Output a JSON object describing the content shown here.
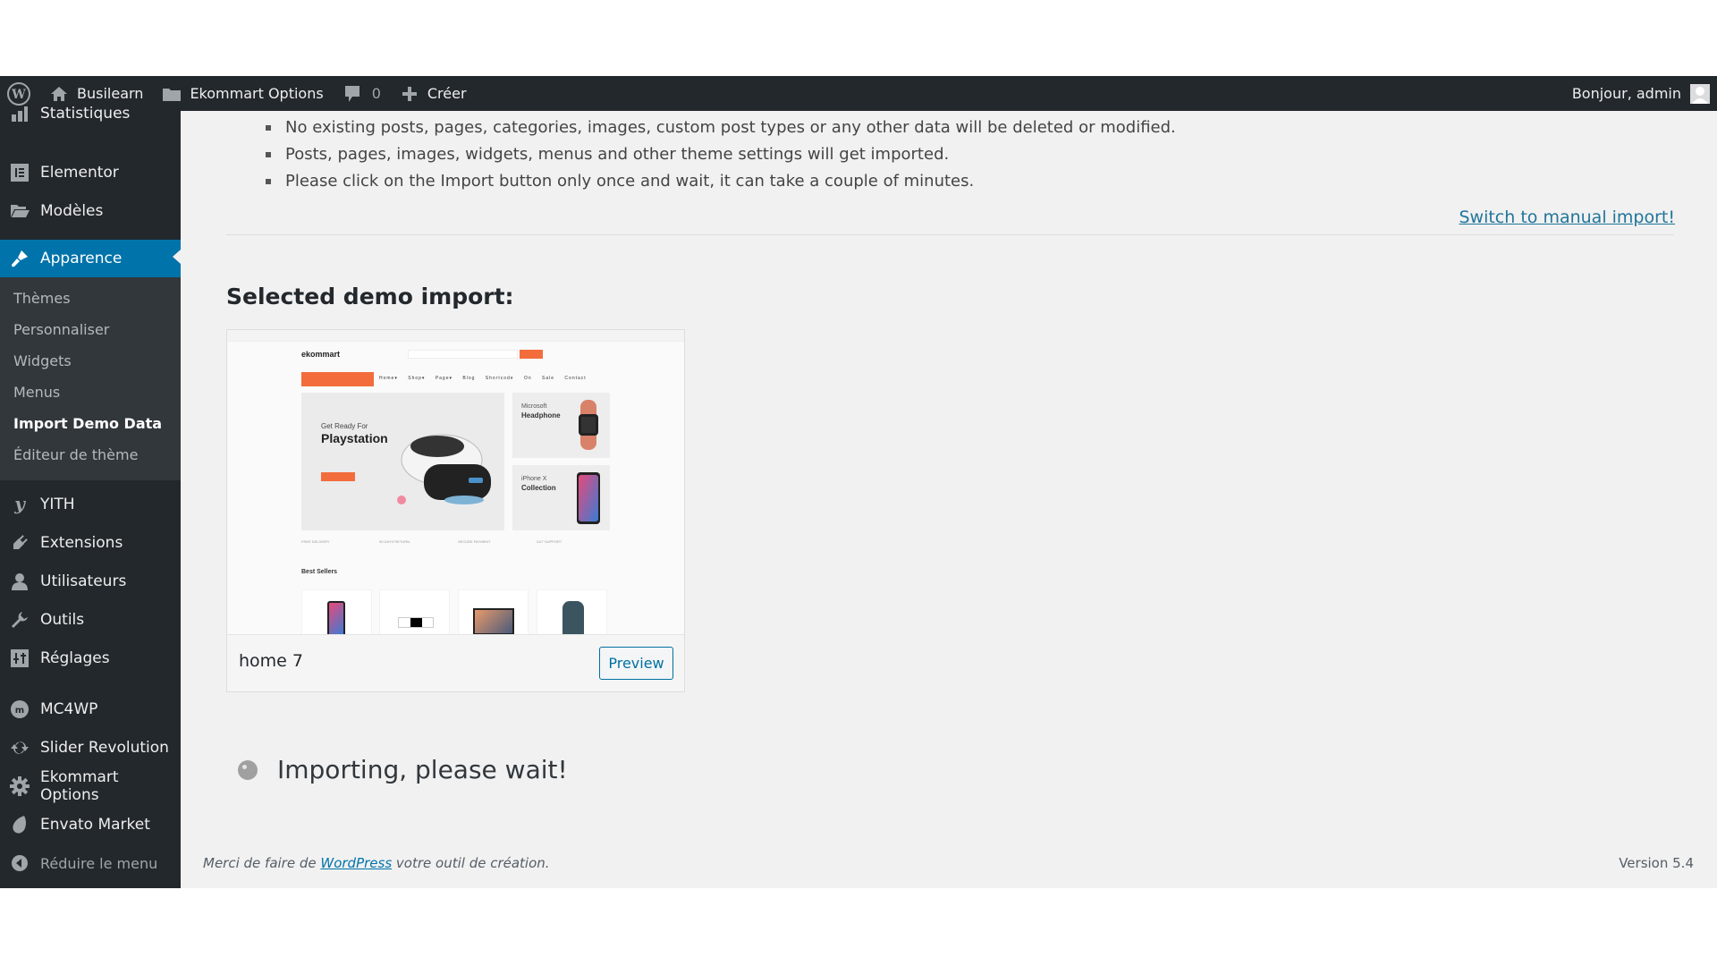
{
  "admin_bar": {
    "site_name": "Busilearn",
    "options_label": "Ekommart Options",
    "comments_count": "0",
    "create_label": "Créer",
    "greeting": "Bonjour, admin"
  },
  "sidebar": {
    "items": [
      {
        "label": "Statistiques",
        "icon": "bar-chart-icon"
      },
      {
        "label": "Elementor",
        "icon": "elementor-icon"
      },
      {
        "label": "Modèles",
        "icon": "folder-icon"
      },
      {
        "label": "Apparence",
        "icon": "paintbrush-icon",
        "active": true
      },
      {
        "label": "YITH",
        "icon": "yith-icon"
      },
      {
        "label": "Extensions",
        "icon": "plugin-icon"
      },
      {
        "label": "Utilisateurs",
        "icon": "user-icon"
      },
      {
        "label": "Outils",
        "icon": "wrench-icon"
      },
      {
        "label": "Réglages",
        "icon": "settings-sliders-icon"
      },
      {
        "label": "MC4WP",
        "icon": "mc4wp-icon"
      },
      {
        "label": "Slider Revolution",
        "icon": "refresh-icon"
      },
      {
        "label": "Ekommart Options",
        "icon": "gear-icon"
      },
      {
        "label": "Envato Market",
        "icon": "leaf-icon"
      }
    ],
    "submenu": [
      {
        "label": "Thèmes"
      },
      {
        "label": "Personnaliser"
      },
      {
        "label": "Widgets"
      },
      {
        "label": "Menus"
      },
      {
        "label": "Import Demo Data",
        "current": true
      },
      {
        "label": "Éditeur de thème"
      }
    ],
    "collapse_label": "Réduire le menu"
  },
  "main": {
    "bullets": [
      "No existing posts, pages, categories, images, custom post types or any other data will be deleted or modified.",
      "Posts, pages, images, widgets, menus and other theme settings will get imported.",
      "Please click on the Import button only once and wait, it can take a couple of minutes."
    ],
    "switch_link": "Switch to manual import!",
    "section_title": "Selected demo import:",
    "demo": {
      "name": "home 7",
      "preview_label": "Preview",
      "screenshot": {
        "logo": "ekommart",
        "nav": "Home▾ Shop▾ Page▾ Blog Shortcode On Sale Contact",
        "hero_sub": "Get Ready For",
        "hero_title": "Playstation",
        "side1_top": "Microsoft",
        "side1_bold": "Headphone",
        "side2_top": "iPhone X",
        "side2_bold": "Collection",
        "best_sellers": "Best Sellers",
        "features": [
          "FREE DELIVERY",
          "90 DAYS RETURN",
          "SECURE PAYMENT",
          "24/7 SUPPORT"
        ]
      }
    },
    "status_text": "Importing, please wait!"
  },
  "footer": {
    "thanks_prefix": "Merci de faire de ",
    "thanks_link": "WordPress",
    "thanks_suffix": " votre outil de création.",
    "version": "Version 5.4"
  },
  "colors": {
    "admin_bar_bg": "#23282d",
    "accent": "#0073aa",
    "link": "#21759b",
    "store_accent": "#f36c3c"
  }
}
